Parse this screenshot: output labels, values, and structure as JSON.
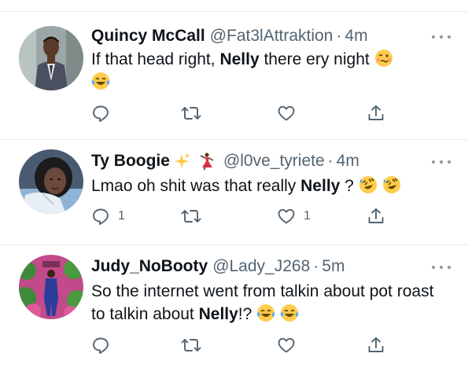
{
  "tweets": [
    {
      "name": "Quincy McCall",
      "handle": "@Fat3lAttraktion",
      "separator": "·",
      "time": "4m",
      "text_1": "If that head right, ",
      "text_bold": "Nelly",
      "text_2": " there ery night",
      "emojis": [
        "woozy-face-emoji",
        "tears-of-joy-emoji"
      ],
      "reply_count": "",
      "retweet_count": "",
      "like_count": "",
      "avatar_colors": {
        "bg": "#9aa7a6",
        "suit": "#4a5060",
        "skin": "#5a3a28"
      }
    },
    {
      "name": "Ty Boogie",
      "name_decorations": [
        "sparkles-emoji",
        "dancer-emoji"
      ],
      "handle": "@l0ve_tyriete",
      "separator": "·",
      "time": "4m",
      "text_1": "Lmao oh shit was that really ",
      "text_bold": "Nelly",
      "text_2": " ? ",
      "emojis": [
        "rofl-emoji",
        "rofl-emoji"
      ],
      "reply_count": "1",
      "retweet_count": "",
      "like_count": "1",
      "avatar_colors": {
        "bg": "#4a5a70",
        "hair": "#1d1a1c",
        "skin": "#6b4a3c"
      }
    },
    {
      "name": "Judy_NoBooty",
      "handle": "@Lady_J268",
      "separator": "·",
      "time": "5m",
      "text_1": "So the internet went from talkin about pot roast to talkin about ",
      "text_bold": "Nelly",
      "text_2": "!? ",
      "emojis": [
        "tears-of-joy-emoji",
        "tears-of-joy-emoji"
      ],
      "reply_count": "",
      "retweet_count": "",
      "like_count": "",
      "avatar_colors": {
        "bg": "#c24a8a",
        "leaves": "#3f8a3a",
        "outfit": "#2a3d9a"
      }
    }
  ],
  "icons": {
    "reply": "reply-icon",
    "retweet": "retweet-icon",
    "like": "like-icon",
    "share": "share-icon",
    "more": "more-icon"
  },
  "colors": {
    "icon": "#536471",
    "text": "#0f1419",
    "secondary": "#536471",
    "divider": "#e6ecf0",
    "emoji_yellow": "#ffcc4d"
  }
}
